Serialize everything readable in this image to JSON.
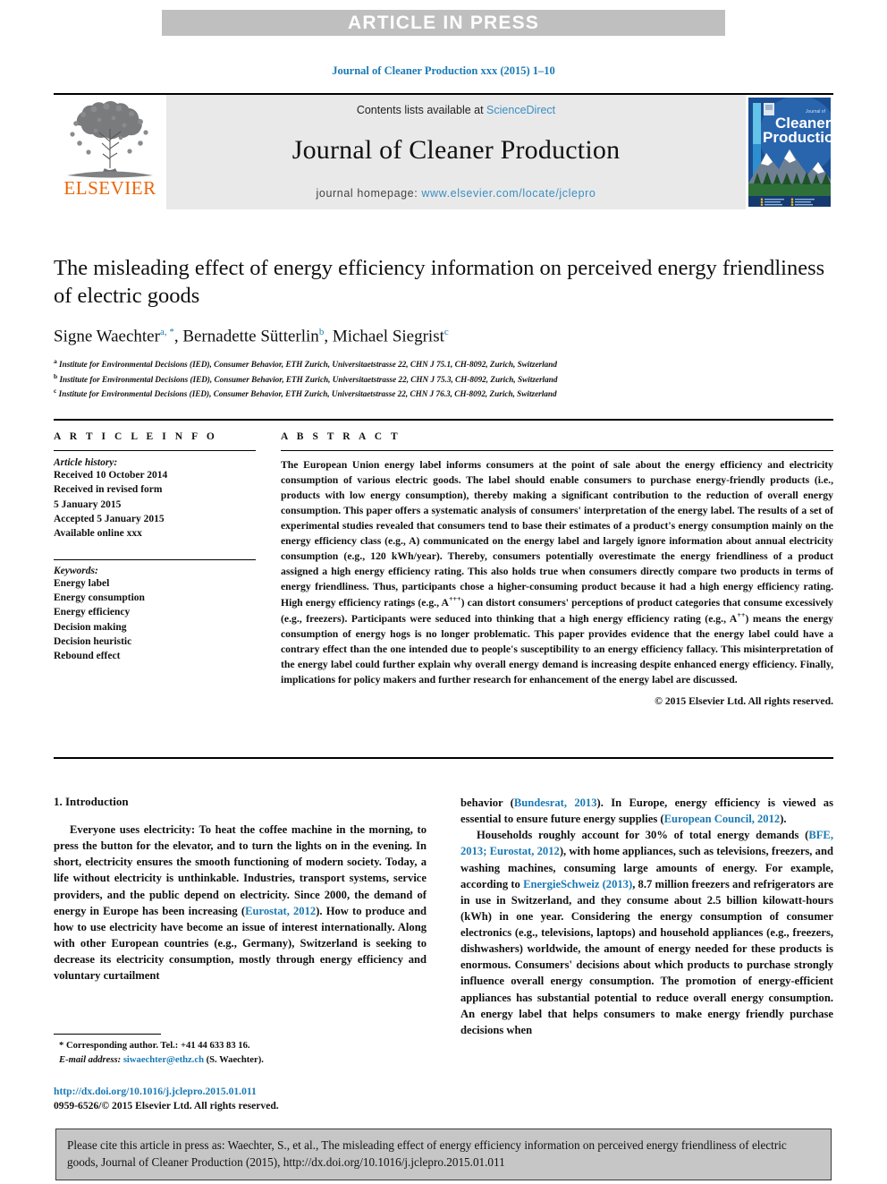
{
  "banner": {
    "text": "ARTICLE IN PRESS"
  },
  "running_head": {
    "text": "Journal of Cleaner Production xxx (2015) 1–10"
  },
  "masthead": {
    "contents_prefix": "Contents lists available at ",
    "sciencedirect": "ScienceDirect",
    "journal_title": "Journal of Cleaner Production",
    "homepage_prefix": "journal homepage: ",
    "homepage_url": "www.elsevier.com/locate/jclepro",
    "publisher": "ELSEVIER",
    "cover_title_small": "Journal of",
    "cover_title_line1": "Cleaner",
    "cover_title_line2": "Production"
  },
  "article": {
    "title": "The misleading effect of energy efficiency information on perceived energy friendliness of electric goods",
    "authors": [
      {
        "name": "Signe Waechter",
        "marks": "a, *"
      },
      {
        "name": "Bernadette Sütterlin",
        "marks": "b"
      },
      {
        "name": "Michael Siegrist",
        "marks": "c"
      }
    ],
    "affiliations": [
      {
        "mark": "a",
        "text": "Institute for Environmental Decisions (IED), Consumer Behavior, ETH Zurich, Universitaetstrasse 22, CHN J 75.1, CH-8092, Zurich, Switzerland"
      },
      {
        "mark": "b",
        "text": "Institute for Environmental Decisions (IED), Consumer Behavior, ETH Zurich, Universitaetstrasse 22, CHN J 75.3, CH-8092, Zurich, Switzerland"
      },
      {
        "mark": "c",
        "text": "Institute for Environmental Decisions (IED), Consumer Behavior, ETH Zurich, Universitaetstrasse 22, CHN J 76.3, CH-8092, Zurich, Switzerland"
      }
    ]
  },
  "article_info": {
    "heading": "A R T I C L E  I N F O",
    "history_label": "Article history:",
    "history_lines": [
      "Received 10 October 2014",
      "Received in revised form",
      "5 January 2015",
      "Accepted 5 January 2015",
      "Available online xxx"
    ],
    "keywords_label": "Keywords:",
    "keywords": [
      "Energy label",
      "Energy consumption",
      "Energy efficiency",
      "Decision making",
      "Decision heuristic",
      "Rebound effect"
    ]
  },
  "abstract": {
    "heading": "A B S T R A C T",
    "text": "The European Union energy label informs consumers at the point of sale about the energy efficiency and electricity consumption of various electric goods. The label should enable consumers to purchase energy-friendly products (i.e., products with low energy consumption), thereby making a significant contribution to the reduction of overall energy consumption. This paper offers a systematic analysis of consumers' interpretation of the energy label. The results of a set of experimental studies revealed that consumers tend to base their estimates of a product's energy consumption mainly on the energy efficiency class (e.g., A) communicated on the energy label and largely ignore information about annual electricity consumption (e.g., 120 kWh/year). Thereby, consumers potentially overestimate the energy friendliness of a product assigned a high energy efficiency rating. This also holds true when consumers directly compare two products in terms of energy friendliness. Thus, participants chose a higher-consuming product because it had a high energy efficiency rating. High energy efficiency ratings (e.g., A+++) can distort consumers' perceptions of product categories that consume excessively (e.g., freezers). Participants were seduced into thinking that a high energy efficiency rating (e.g., A++) means the energy consumption of energy hogs is no longer problematic. This paper provides evidence that the energy label could have a contrary effect than the one intended due to people's susceptibility to an energy efficiency fallacy. This misinterpretation of the energy label could further explain why overall energy demand is increasing despite enhanced energy efficiency. Finally, implications for policy makers and further research for enhancement of the energy label are discussed.",
    "copyright": "© 2015 Elsevier Ltd. All rights reserved."
  },
  "body": {
    "section_title": "1. Introduction",
    "left_paragraph": "Everyone uses electricity: To heat the coffee machine in the morning, to press the button for the elevator, and to turn the lights on in the evening. In short, electricity ensures the smooth functioning of modern society. Today, a life without electricity is unthinkable. Industries, transport systems, service providers, and the public depend on electricity. Since 2000, the demand of energy in Europe has been increasing (Eurostat, 2012). How to produce and how to use electricity have become an issue of interest internationally. Along with other European countries (e.g., Germany), Switzerland is seeking to decrease its electricity consumption, mostly through energy efficiency and voluntary curtailment",
    "right_paragraph_1": "behavior (Bundesrat, 2013). In Europe, energy efficiency is viewed as essential to ensure future energy supplies (European Council, 2012).",
    "right_paragraph_2": "Households roughly account for 30% of total energy demands (BFE, 2013; Eurostat, 2012), with home appliances, such as televisions, freezers, and washing machines, consuming large amounts of energy. For example, according to EnergieSchweiz (2013), 8.7 million freezers and refrigerators are in use in Switzerland, and they consume about 2.5 billion kilowatt-hours (kWh) in one year. Considering the energy consumption of consumer electronics (e.g., televisions, laptops) and household appliances (e.g., freezers, dishwashers) worldwide, the amount of energy needed for these products is enormous. Consumers' decisions about which products to purchase strongly influence overall energy consumption. The promotion of energy-efficient appliances has substantial potential to reduce overall energy consumption. An energy label that helps consumers to make energy friendly purchase decisions when"
  },
  "footnote": {
    "corresponding": "* Corresponding author. Tel.: +41 44 633 83 16.",
    "email_label": "E-mail address:",
    "email": "siwaechter@ethz.ch",
    "email_suffix": "(S. Waechter)."
  },
  "doi_block": {
    "doi_url": "http://dx.doi.org/10.1016/j.jclepro.2015.01.011",
    "issn_line": "0959-6526/© 2015 Elsevier Ltd. All rights reserved."
  },
  "cite_box": {
    "text": "Please cite this article in press as: Waechter, S., et al., The misleading effect of energy efficiency information on perceived energy friendliness of electric goods, Journal of Cleaner Production (2015), http://dx.doi.org/10.1016/j.jclepro.2015.01.011"
  },
  "colors": {
    "banner_bg": "#bfbfbf",
    "link_blue": "#1a7ab5",
    "elsevier_orange": "#eb6608",
    "masthead_grey": "#e9e9e9",
    "cite_box_grey": "#c6c6c6"
  }
}
